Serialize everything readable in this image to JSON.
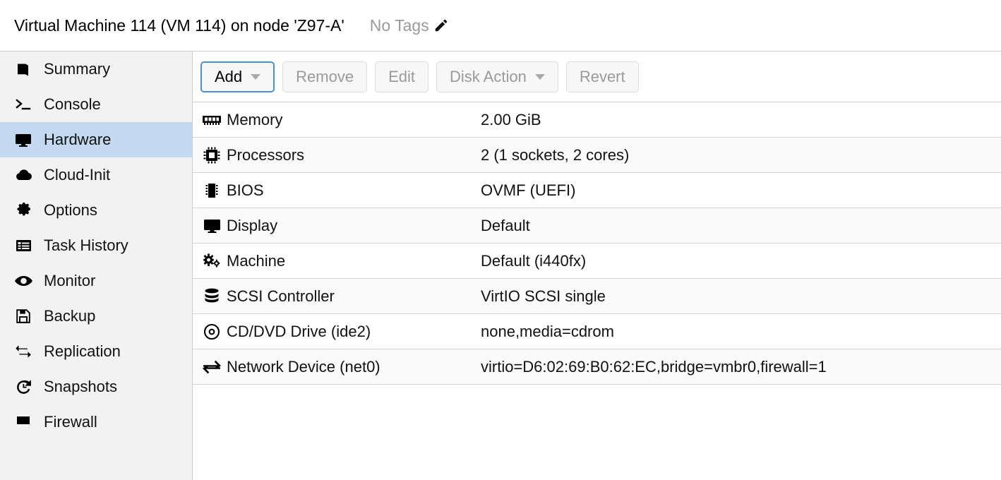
{
  "header": {
    "title": "Virtual Machine 114 (VM 114) on node 'Z97-A'",
    "tags_label": "No Tags",
    "edit_icon": "pencil-icon"
  },
  "sidebar": {
    "items": [
      {
        "label": "Summary",
        "icon": "book-icon",
        "active": false
      },
      {
        "label": "Console",
        "icon": "terminal-icon",
        "active": false
      },
      {
        "label": "Hardware",
        "icon": "display-icon",
        "active": true
      },
      {
        "label": "Cloud-Init",
        "icon": "cloud-icon",
        "active": false
      },
      {
        "label": "Options",
        "icon": "gear-icon",
        "active": false
      },
      {
        "label": "Task History",
        "icon": "list-icon",
        "active": false
      },
      {
        "label": "Monitor",
        "icon": "eye-icon",
        "active": false
      },
      {
        "label": "Backup",
        "icon": "floppy-disk-icon",
        "active": false
      },
      {
        "label": "Replication",
        "icon": "repeat-icon",
        "active": false
      },
      {
        "label": "Snapshots",
        "icon": "history-icon",
        "active": false
      },
      {
        "label": "Firewall",
        "icon": "shield-icon",
        "active": false
      }
    ]
  },
  "toolbar": {
    "buttons": [
      {
        "label": "Add",
        "enabled": true,
        "has_caret": true
      },
      {
        "label": "Remove",
        "enabled": false,
        "has_caret": false
      },
      {
        "label": "Edit",
        "enabled": false,
        "has_caret": false
      },
      {
        "label": "Disk Action",
        "enabled": false,
        "has_caret": true
      },
      {
        "label": "Revert",
        "enabled": false,
        "has_caret": false
      }
    ]
  },
  "hardware_table": {
    "rows": [
      {
        "icon": "memory-icon",
        "name": "Memory",
        "value": "2.00 GiB"
      },
      {
        "icon": "cpu-icon",
        "name": "Processors",
        "value": "2 (1 sockets, 2 cores)"
      },
      {
        "icon": "bios-chip-icon",
        "name": "BIOS",
        "value": "OVMF (UEFI)"
      },
      {
        "icon": "display-icon",
        "name": "Display",
        "value": "Default"
      },
      {
        "icon": "gears-icon",
        "name": "Machine",
        "value": "Default (i440fx)"
      },
      {
        "icon": "database-icon",
        "name": "SCSI Controller",
        "value": "VirtIO SCSI single"
      },
      {
        "icon": "disc-icon",
        "name": "CD/DVD Drive (ide2)",
        "value": "none,media=cdrom"
      },
      {
        "icon": "exchange-icon",
        "name": "Network Device (net0)",
        "value": "virtio=D6:02:69:B0:62:EC,bridge=vmbr0,firewall=1"
      }
    ]
  },
  "colors": {
    "active_nav_bg": "#c3d9ef",
    "sidebar_bg": "#f2f2f2",
    "accent_border": "#4a90d9",
    "row_alt_bg": "#fafafa",
    "disabled_text": "#9a9a9a"
  }
}
